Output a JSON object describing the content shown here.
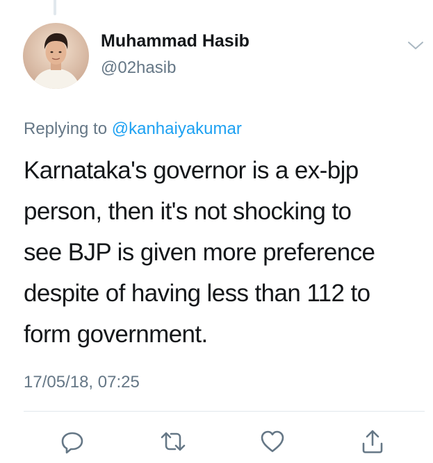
{
  "tweet": {
    "author": {
      "name": "Muhammad Hasib",
      "handle": "@02hasib",
      "avatar_icon": "profile-photo"
    },
    "reply": {
      "prefix": "Replying to",
      "mention": "@kanhaiyakumar"
    },
    "text_lines": [
      "Karnataka's governor is a ex-bjp",
      "person, then it's not shocking to",
      "see BJP is given more preference",
      "despite of having less than 112 to",
      "form government."
    ],
    "timestamp": "17/05/18, 07:25"
  },
  "actions": {
    "reply_icon": "reply-icon",
    "retweet_icon": "retweet-icon",
    "like_icon": "heart-icon",
    "share_icon": "share-icon",
    "menu_icon": "chevron-down-icon"
  },
  "colors": {
    "text_primary": "#14171a",
    "text_secondary": "#657786",
    "link": "#1da1f2",
    "divider": "#e1e8ed",
    "icon": "#657786"
  }
}
